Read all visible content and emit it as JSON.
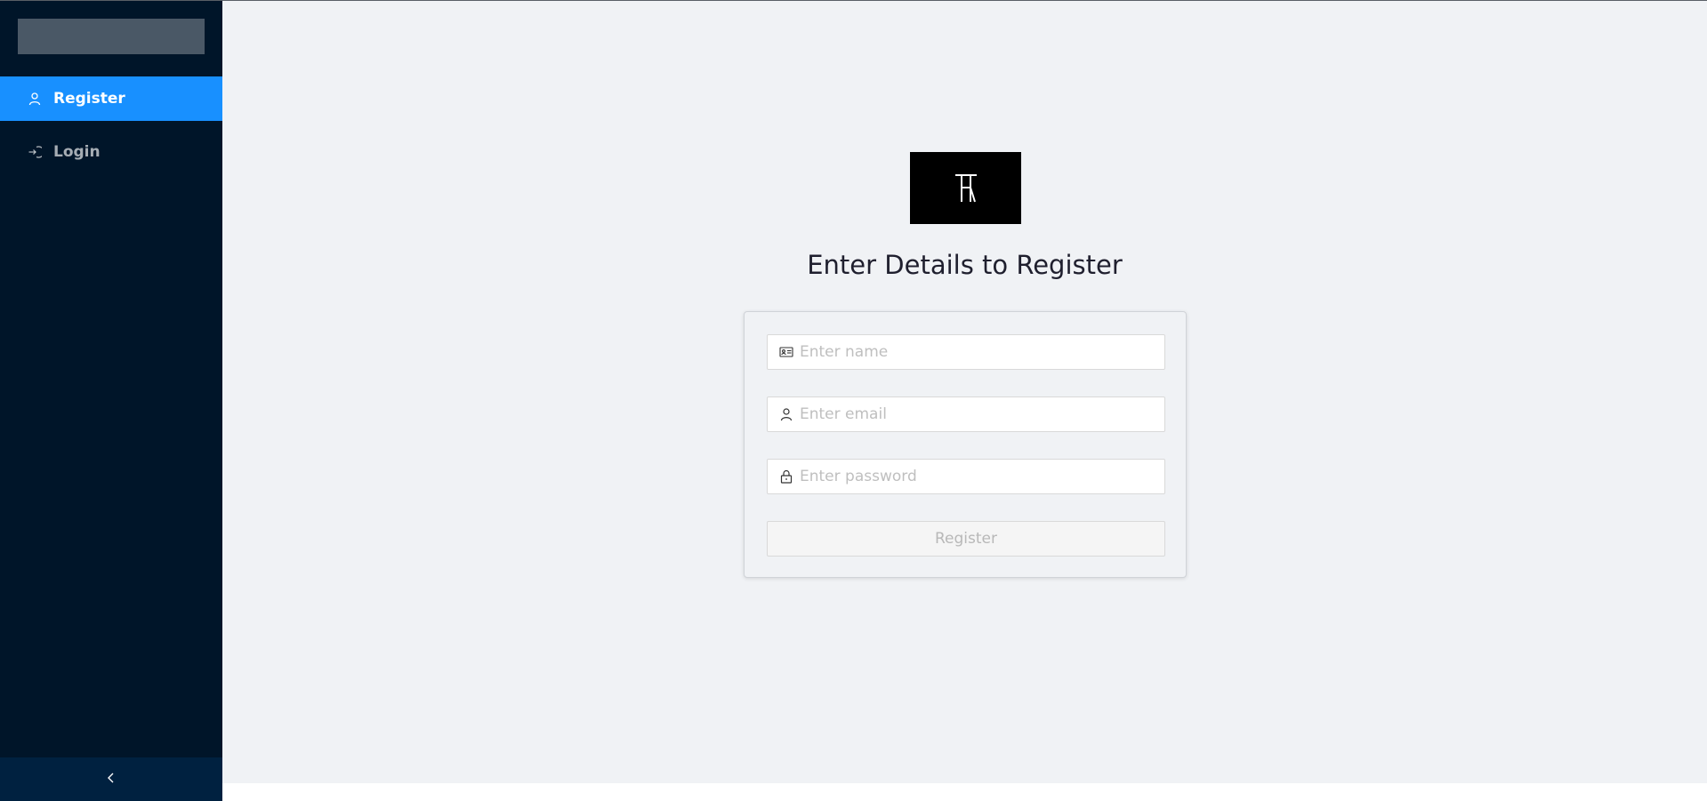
{
  "sidebar": {
    "items": [
      {
        "label": "Register",
        "icon": "user-icon",
        "active": true
      },
      {
        "label": "Login",
        "icon": "login-icon",
        "active": false
      }
    ],
    "collapse_icon": "chevron-left-icon"
  },
  "main": {
    "logo_icon": "brand-monogram-icon",
    "title": "Enter Details to Register",
    "form": {
      "name_placeholder": "Enter name",
      "email_placeholder": "Enter email",
      "password_placeholder": "Enter password",
      "submit_label": "Register"
    }
  },
  "colors": {
    "sidebar_bg": "#001529",
    "active_item": "#1890ff",
    "content_bg": "#f0f2f5"
  }
}
